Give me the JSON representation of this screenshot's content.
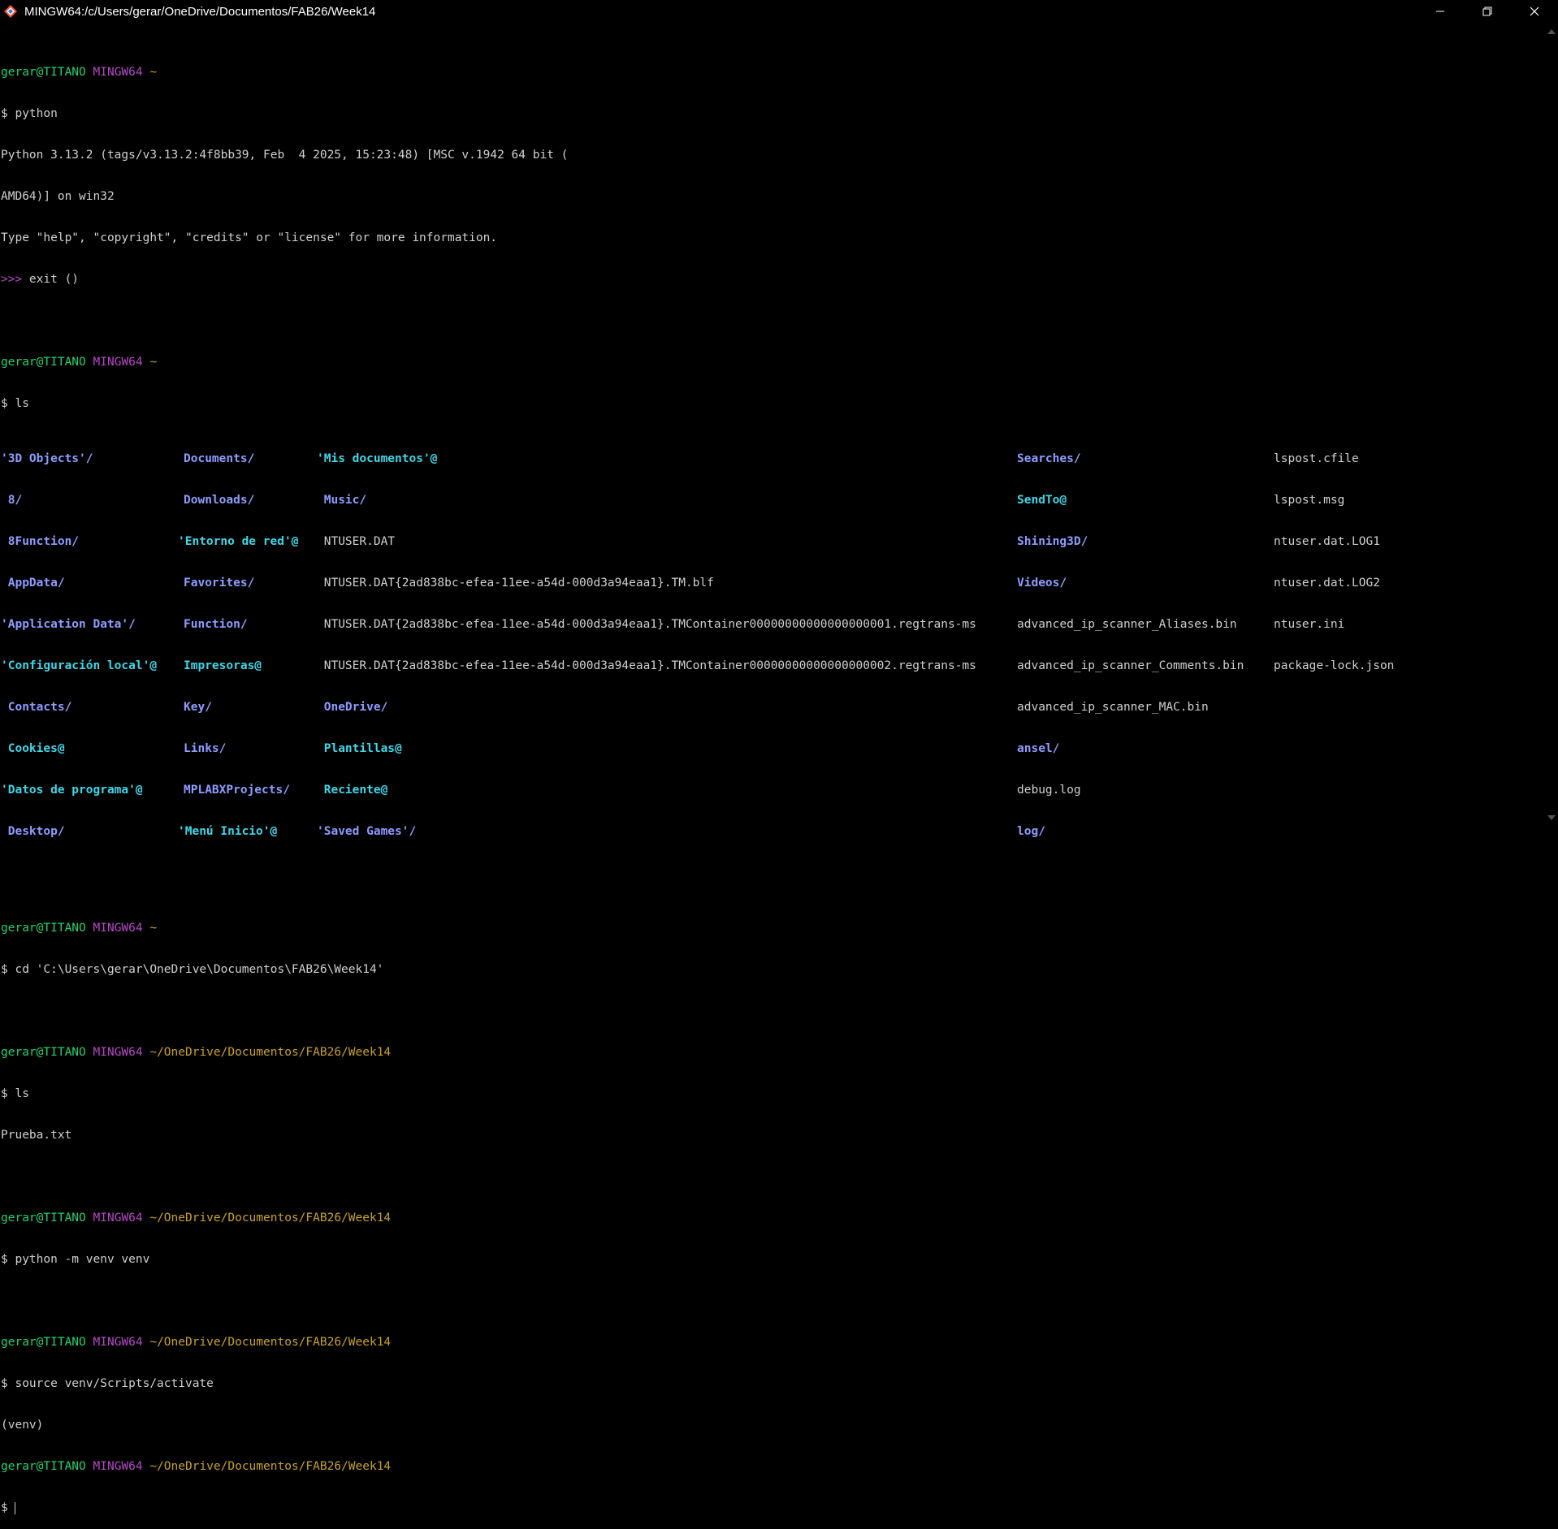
{
  "window": {
    "title": "MINGW64:/c/Users/gerar/OneDrive/Documentos/FAB26/Week14",
    "icon": "git-bash-icon",
    "controls": {
      "minimize": "minimize-icon",
      "maximize": "restore-icon",
      "close": "close-icon"
    }
  },
  "prompt": {
    "user": "gerar@TITANO",
    "shell": "MINGW64",
    "home": "~",
    "cwd": "~/OneDrive/Documentos/FAB26/Week14",
    "symbol": "$"
  },
  "lines": {
    "cmd_python": "$ python",
    "py_banner_1": "Python 3.13.2 (tags/v3.13.2:4f8bb39, Feb  4 2025, 15:23:48) [MSC v.1942 64 bit (",
    "py_banner_2": "AMD64)] on win32",
    "py_banner_3": "Type \"help\", \"copyright\", \"credits\" or \"license\" for more information.",
    "py_prompt": ">>>",
    "py_exit": " exit ()",
    "cmd_ls": "$ ls",
    "cmd_cd": "$ cd 'C:\\Users\\gerar\\OneDrive\\Documentos\\FAB26\\Week14'",
    "cmd_ls2": "$ ls",
    "ls2_output": "Prueba.txt",
    "cmd_venv": "$ python -m venv venv",
    "cmd_activate": "$ source venv/Scripts/activate",
    "venv": "(venv)",
    "last_prompt": "$ "
  },
  "ls_listing": {
    "col1": [
      "'3D Objects'/",
      " 8/",
      " 8Function/",
      " AppData/",
      "'Application Data'/",
      "'Configuración local'@",
      " Contacts/",
      " Cookies@",
      "'Datos de programa'@",
      " Desktop/"
    ],
    "col2": [
      "Documents/",
      "Downloads/",
      "'Entorno de red'@",
      "Favorites/",
      "Function/",
      "Impresoras@",
      "Key/",
      "Links/",
      "MPLABXProjects/",
      "'Menú Inicio'@"
    ],
    "col3": [
      "'Mis documentos'@",
      " Music/",
      " NTUSER.DAT",
      " NTUSER.DAT{2ad838bc-efea-11ee-a54d-000d3a94eaa1}.TM.blf",
      " NTUSER.DAT{2ad838bc-efea-11ee-a54d-000d3a94eaa1}.TMContainer00000000000000000001.regtrans-ms",
      " NTUSER.DAT{2ad838bc-efea-11ee-a54d-000d3a94eaa1}.TMContainer00000000000000000002.regtrans-ms",
      " OneDrive/",
      " Plantillas@",
      " Reciente@",
      "'Saved Games'/"
    ],
    "col4": [
      "Searches/",
      "SendTo@",
      "Shining3D/",
      "Videos/",
      "advanced_ip_scanner_Aliases.bin",
      "advanced_ip_scanner_Comments.bin",
      "advanced_ip_scanner_MAC.bin",
      "ansel/",
      "debug.log",
      "log/"
    ],
    "col5": [
      "lspost.cfile",
      "lspost.msg",
      "ntuser.dat.LOG1",
      "ntuser.dat.LOG2",
      "ntuser.ini",
      "package-lock.json"
    ]
  },
  "colors": {
    "user": "#23d16f",
    "host": "#b548c6",
    "path": "#c9a227",
    "dir": "#8f9cff",
    "symlink": "#3fd7e8",
    "text": "#d0d0d0"
  }
}
